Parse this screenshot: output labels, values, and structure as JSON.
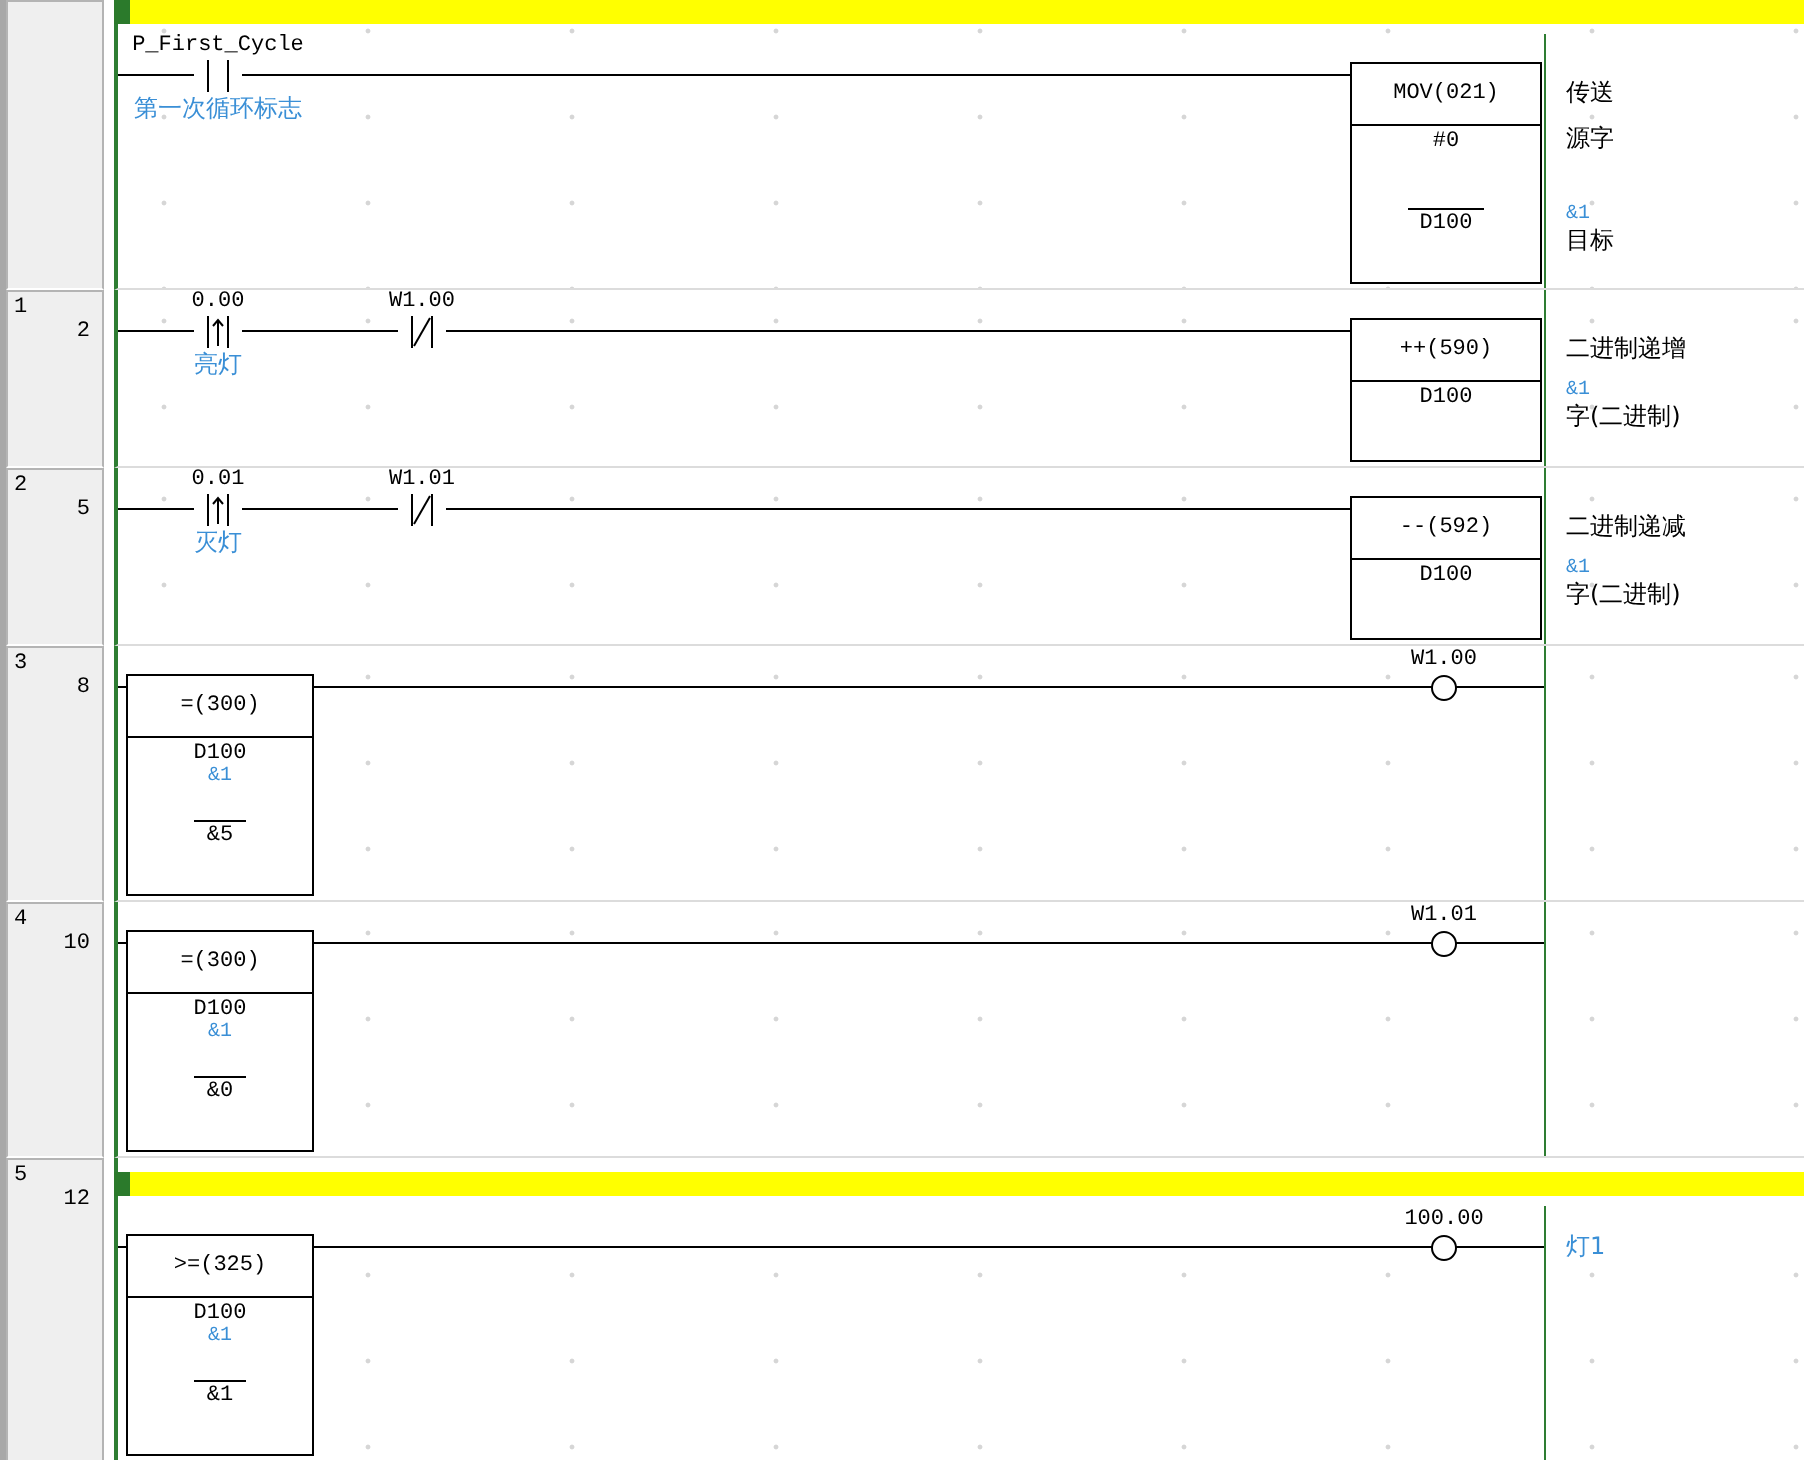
{
  "rungs": [
    {
      "comment_bar": true,
      "inputs": [
        {
          "kind": "contact",
          "negated": false,
          "rising_edge": false,
          "operand": "P_First_Cycle",
          "comment": "第一次循环标志"
        }
      ],
      "output": {
        "kind": "instruction",
        "mnemonic": "MOV(021)",
        "title": "传送",
        "operands": [
          {
            "value": "#0",
            "label": "源字"
          },
          {
            "value": "D100",
            "note": "&1",
            "label": "目标"
          }
        ]
      }
    },
    {
      "number": "1",
      "step": "2",
      "comment_bar": false,
      "inputs": [
        {
          "kind": "contact",
          "negated": false,
          "rising_edge": true,
          "operand": "0.00",
          "comment": "亮灯"
        },
        {
          "kind": "contact",
          "negated": true,
          "rising_edge": false,
          "operand": "W1.00"
        }
      ],
      "output": {
        "kind": "instruction",
        "mnemonic": "++(590)",
        "title": "二进制递增",
        "operands": [
          {
            "value": "D100",
            "note": "&1",
            "label": "字(二进制)"
          }
        ]
      }
    },
    {
      "number": "2",
      "step": "5",
      "comment_bar": false,
      "inputs": [
        {
          "kind": "contact",
          "negated": false,
          "rising_edge": true,
          "operand": "0.01",
          "comment": "灭灯"
        },
        {
          "kind": "contact",
          "negated": true,
          "rising_edge": false,
          "operand": "W1.01"
        }
      ],
      "output": {
        "kind": "instruction",
        "mnemonic": "--(592)",
        "title": "二进制递减",
        "operands": [
          {
            "value": "D100",
            "note": "&1",
            "label": "字(二进制)"
          }
        ]
      }
    },
    {
      "number": "3",
      "step": "8",
      "comment_bar": false,
      "inputs": [
        {
          "kind": "compare",
          "mnemonic": "=(300)",
          "operands": [
            {
              "value": "D100",
              "comment": "&1"
            },
            {
              "value": "&5"
            }
          ]
        }
      ],
      "output": {
        "kind": "coil",
        "operand": "W1.00"
      }
    },
    {
      "number": "4",
      "step": "10",
      "comment_bar": false,
      "inputs": [
        {
          "kind": "compare",
          "mnemonic": "=(300)",
          "operands": [
            {
              "value": "D100",
              "comment": "&1"
            },
            {
              "value": "&0"
            }
          ]
        }
      ],
      "output": {
        "kind": "coil",
        "operand": "W1.01"
      }
    },
    {
      "number": "5",
      "step": "12",
      "comment_bar": true,
      "inputs": [
        {
          "kind": "compare",
          "mnemonic": ">=(325)",
          "operands": [
            {
              "value": "D100",
              "comment": "&1"
            },
            {
              "value": "&1"
            }
          ]
        }
      ],
      "output": {
        "kind": "coil",
        "operand": "100.00",
        "comment": "灯1"
      }
    }
  ]
}
